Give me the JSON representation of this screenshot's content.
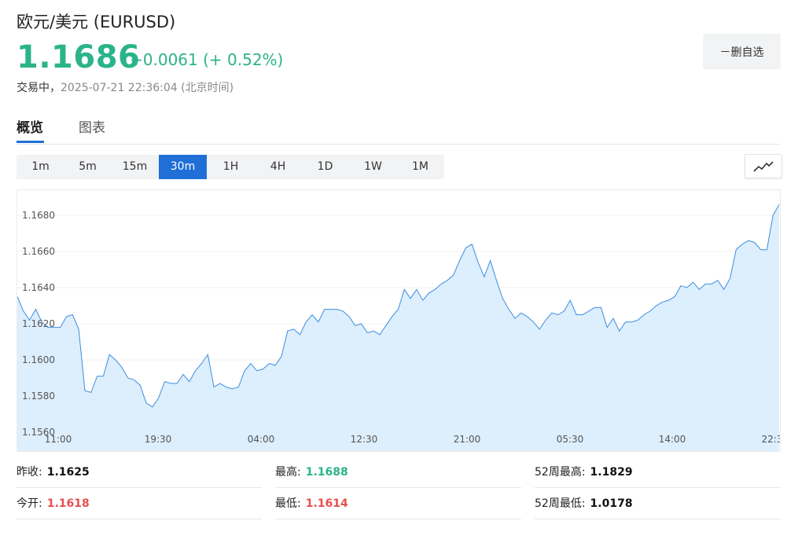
{
  "header": {
    "title": "欧元/美元  (EURUSD)",
    "price": "1.1686",
    "change": "+0.0061 (+ 0.52%)",
    "status_label": "交易中，",
    "status_time": "2025-07-21 22:36:04  (北京时间)",
    "watch_button": "－删自选"
  },
  "tabs": [
    {
      "label": "概览",
      "active": true
    },
    {
      "label": "图表",
      "active": false
    }
  ],
  "periods": [
    {
      "label": "1m"
    },
    {
      "label": "5m"
    },
    {
      "label": "15m"
    },
    {
      "label": "30m",
      "active": true
    },
    {
      "label": "1H"
    },
    {
      "label": "4H"
    },
    {
      "label": "1D"
    },
    {
      "label": "1W"
    },
    {
      "label": "1M"
    }
  ],
  "chart_type_icon": "line-chart-icon",
  "colors": {
    "up": "#2bb38a",
    "down": "#e84f4f",
    "accent": "#1f6fd6",
    "area": "#ddeefc",
    "line": "#3d8fe0"
  },
  "chart_data": {
    "type": "area",
    "y_ticks": [
      "1.1680",
      "1.1660",
      "1.1640",
      "1.1620",
      "1.1600",
      "1.1580",
      "1.1560"
    ],
    "ylim": [
      1.156,
      1.1686
    ],
    "x_ticks": [
      "11:00",
      "19:30",
      "04:00",
      "12:30",
      "21:00",
      "05:30",
      "14:00",
      "22:3"
    ],
    "values": [
      1.1635,
      1.1627,
      1.1622,
      1.1628,
      1.1621,
      1.1618,
      1.1618,
      1.1618,
      1.1624,
      1.1625,
      1.1617,
      1.1583,
      1.1582,
      1.1591,
      1.1591,
      1.1603,
      1.16,
      1.1596,
      1.159,
      1.1589,
      1.1586,
      1.1576,
      1.1574,
      1.1579,
      1.1588,
      1.1587,
      1.1587,
      1.1592,
      1.1588,
      1.1594,
      1.1598,
      1.1603,
      1.1585,
      1.1587,
      1.1585,
      1.1584,
      1.1585,
      1.1594,
      1.1598,
      1.1594,
      1.1595,
      1.1598,
      1.1597,
      1.1602,
      1.1616,
      1.1617,
      1.1614,
      1.1621,
      1.1625,
      1.1621,
      1.1628,
      1.1628,
      1.1628,
      1.1627,
      1.1624,
      1.1619,
      1.162,
      1.1615,
      1.1616,
      1.1614,
      1.1619,
      1.1624,
      1.1628,
      1.1639,
      1.1634,
      1.1639,
      1.1633,
      1.1637,
      1.1639,
      1.1642,
      1.1644,
      1.1647,
      1.1655,
      1.1662,
      1.1664,
      1.1654,
      1.1646,
      1.1655,
      1.1644,
      1.1634,
      1.1628,
      1.1623,
      1.1626,
      1.1624,
      1.1621,
      1.1617,
      1.1622,
      1.1626,
      1.1625,
      1.1627,
      1.1633,
      1.1625,
      1.1625,
      1.1627,
      1.1629,
      1.1629,
      1.1618,
      1.1623,
      1.1616,
      1.1621,
      1.1621,
      1.1622,
      1.1625,
      1.1627,
      1.163,
      1.1632,
      1.1633,
      1.1635,
      1.1641,
      1.164,
      1.1643,
      1.1639,
      1.1642,
      1.1642,
      1.1644,
      1.1639,
      1.1645,
      1.1661,
      1.1664,
      1.1666,
      1.1665,
      1.1661,
      1.1661,
      1.168,
      1.1686
    ]
  },
  "stats": [
    {
      "label": "昨收:",
      "value": "1.1625",
      "color": "black"
    },
    {
      "label": "最高:",
      "value": "1.1688",
      "color": "green"
    },
    {
      "label": "52周最高:",
      "value": "1.1829",
      "color": "black"
    },
    {
      "label": "今开:",
      "value": "1.1618",
      "color": "red"
    },
    {
      "label": "最低:",
      "value": "1.1614",
      "color": "red"
    },
    {
      "label": "52周最低:",
      "value": "1.0178",
      "color": "black"
    }
  ]
}
